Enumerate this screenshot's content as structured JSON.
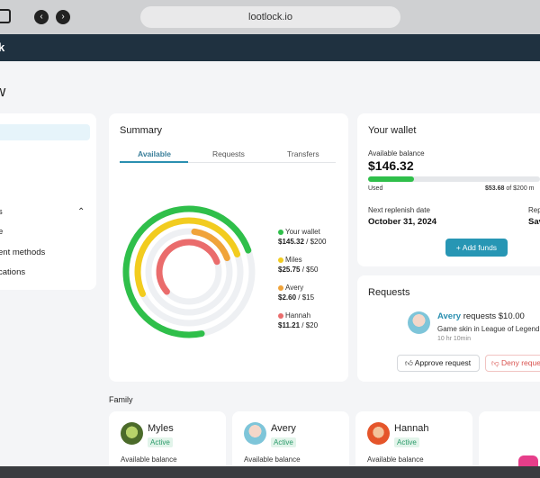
{
  "browser": {
    "url": "lootlock.io",
    "back_icon": "‹",
    "forward_icon": "›"
  },
  "app": {
    "brand_fragment": "k",
    "page_title_fragment": "w"
  },
  "sidebar": {
    "items": [
      {
        "label": ""
      },
      {
        "label": "s"
      },
      {
        "label": "e"
      },
      {
        "label": "ent methods"
      },
      {
        "label": "cations"
      }
    ]
  },
  "summary": {
    "title": "Summary",
    "tabs": [
      "Available",
      "Requests",
      "Transfers"
    ],
    "legend": [
      {
        "name": "Your wallet",
        "amount": "$145.32",
        "total": " / $200",
        "color": "#2fbf4a",
        "fraction": 0.7266
      },
      {
        "name": "Miles",
        "amount": "$25.75",
        "total": " / $50",
        "color": "#f2cc1f",
        "fraction": 0.515
      },
      {
        "name": "Avery",
        "amount": "$2.60",
        "total": " / $15",
        "color": "#f0a33a",
        "fraction": 0.1733
      },
      {
        "name": "Hannah",
        "amount": "$11.21",
        "total": " / $20",
        "color": "#ea6c6c",
        "fraction": 0.5605
      }
    ]
  },
  "wallet": {
    "title": "Your wallet",
    "available_label": "Available balance",
    "balance": "$146.32",
    "used_label": "Used",
    "used_amount": "$53.68",
    "used_suffix": " of $200 m",
    "used_fraction": 0.268,
    "replenish_label": "Next replenish date",
    "replenish_date": "October 31, 2024",
    "right_label": "Rep",
    "right_value": "Saving",
    "add_funds_label": "+  Add funds"
  },
  "requests": {
    "title": "Requests",
    "name": "Avery",
    "text": " requests $10.00",
    "item": "Game skin in League of Legend",
    "time": "10 hr 10min",
    "approve_label": "Approve request",
    "deny_label": "Deny reque"
  },
  "family": {
    "title": "Family",
    "members": [
      {
        "name": "Myles",
        "status": "Active",
        "balance_label": "Available balance"
      },
      {
        "name": "Avery",
        "status": "Active",
        "balance_label": "Available balance"
      },
      {
        "name": "Hannah",
        "status": "Active",
        "balance_label": "Available balance"
      }
    ]
  }
}
